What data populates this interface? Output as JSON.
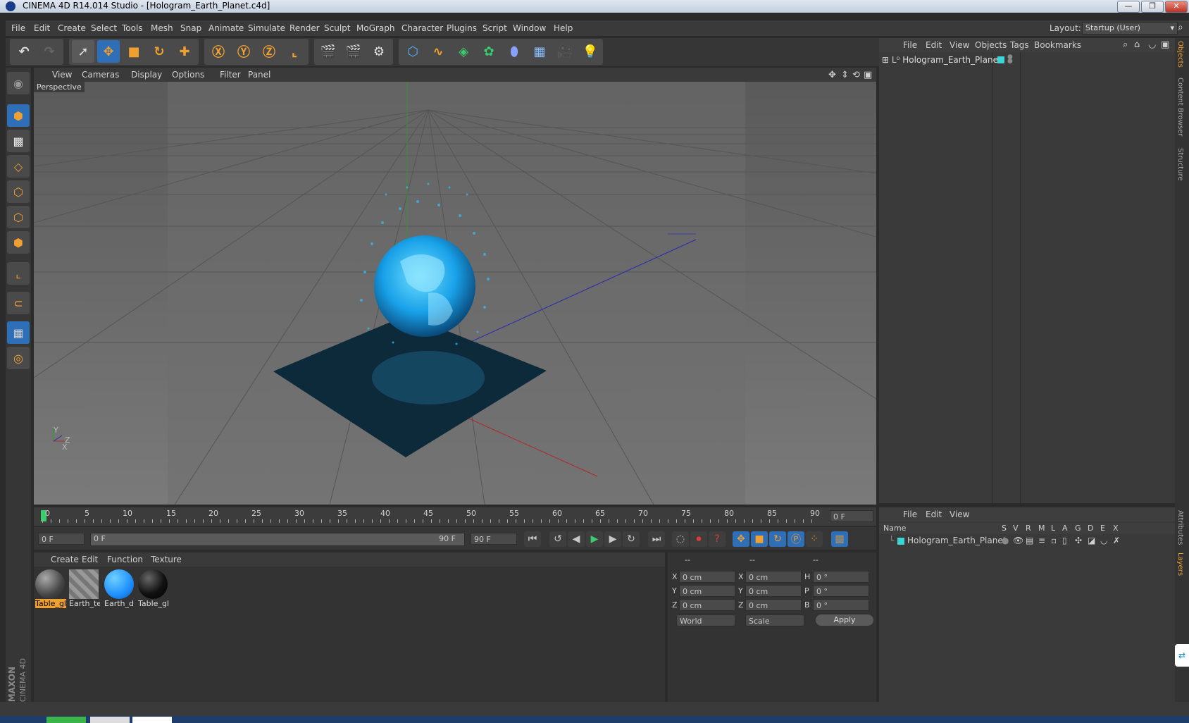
{
  "window": {
    "title": "CINEMA 4D R14.014 Studio - [Hologram_Earth_Planet.c4d]",
    "min": "—",
    "max": "❐",
    "close": "✕"
  },
  "menu": [
    "File",
    "Edit",
    "Create",
    "Select",
    "Tools",
    "Mesh",
    "Snap",
    "Animate",
    "Simulate",
    "Render",
    "Sculpt",
    "MoGraph",
    "Character",
    "Plugins",
    "Script",
    "Window",
    "Help"
  ],
  "layout": {
    "label": "Layout:",
    "value": "Startup (User)"
  },
  "viewport": {
    "menu": [
      "View",
      "Cameras",
      "Display",
      "Options",
      "Filter",
      "Panel"
    ],
    "label": "Perspective"
  },
  "objects": {
    "menu": [
      "File",
      "Edit",
      "View",
      "Objects",
      "Tags",
      "Bookmarks"
    ],
    "item": "Hologram_Earth_Planet"
  },
  "timeline": {
    "ticks": [
      "0",
      "5",
      "10",
      "15",
      "20",
      "25",
      "30",
      "35",
      "40",
      "45",
      "50",
      "55",
      "60",
      "65",
      "70",
      "75",
      "80",
      "85",
      "90"
    ],
    "end_field": "0 F",
    "current": "0 F",
    "range_start": "0 F",
    "range_end": "90 F",
    "max": "90 F"
  },
  "materials": {
    "menu": [
      "Create",
      "Edit",
      "Function",
      "Texture"
    ],
    "items": [
      {
        "label": "Table_gl",
        "color": "#444444"
      },
      {
        "label": "Earth_te",
        "color": "#8a8a8a"
      },
      {
        "label": "Earth_d",
        "color": "#1e90ff"
      },
      {
        "label": "Table_gl",
        "color": "#111111"
      }
    ]
  },
  "coords": {
    "headers": [
      "--",
      "--",
      "--"
    ],
    "rows": [
      {
        "a": "X",
        "av": "0 cm",
        "b": "X",
        "bv": "0 cm",
        "c": "H",
        "cv": "0 °"
      },
      {
        "a": "Y",
        "av": "0 cm",
        "b": "Y",
        "bv": "0 cm",
        "c": "P",
        "cv": "0 °"
      },
      {
        "a": "Z",
        "av": "0 cm",
        "b": "Z",
        "bv": "0 cm",
        "c": "B",
        "cv": "0 °"
      }
    ],
    "world": "World",
    "scale": "Scale",
    "apply": "Apply"
  },
  "layers": {
    "menu": [
      "File",
      "Edit",
      "View"
    ],
    "name_header": "Name",
    "cols": [
      "S",
      "V",
      "R",
      "M",
      "L",
      "A",
      "G",
      "D",
      "E",
      "X"
    ],
    "item": "Hologram_Earth_Planet"
  },
  "sidetabs": [
    "Objects",
    "Content Browser",
    "Structure",
    "Attributes",
    "Layers"
  ],
  "brand": {
    "line1": "MAXON",
    "line2": "CINEMA 4D"
  },
  "colors": {
    "accent": "#f0a030",
    "hologram": "#28b4f0",
    "teal": "#3dd6d6"
  }
}
